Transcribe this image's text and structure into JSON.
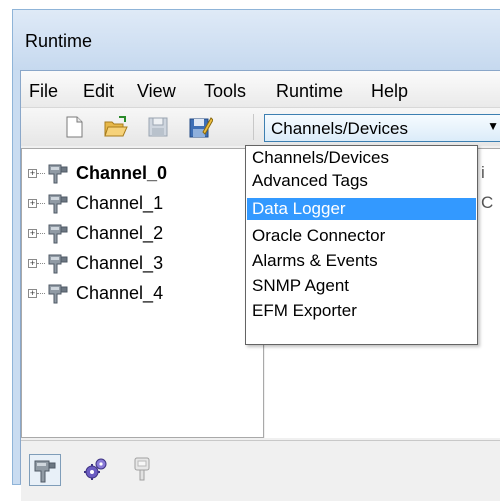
{
  "window": {
    "title": "Runtime"
  },
  "menu": [
    "File",
    "Edit",
    "View",
    "Tools",
    "Runtime",
    "Help"
  ],
  "toolbar": {
    "buttons": [
      "new-document-icon",
      "open-folder-icon",
      "save-icon",
      "save-as-icon"
    ],
    "view_selector": "Channels/Devices"
  },
  "tree": {
    "items": [
      {
        "label": "Channel_0",
        "bold": true
      },
      {
        "label": "Channel_1",
        "bold": false
      },
      {
        "label": "Channel_2",
        "bold": false
      },
      {
        "label": "Channel_3",
        "bold": false
      },
      {
        "label": "Channel_4",
        "bold": false
      }
    ]
  },
  "right_pane": {
    "fragment_1": "i",
    "fragment_2": "C"
  },
  "dropdown": {
    "items": [
      "Channels/Devices",
      "Advanced Tags",
      "Data Logger",
      "Oracle Connector",
      "Alarms & Events",
      "SNMP Agent",
      "EFM Exporter"
    ],
    "highlighted_index": 2
  },
  "bottom_toolbar": {
    "buttons": [
      "channel-view-icon",
      "gears-icon",
      "device-disabled-icon"
    ],
    "active_index": 0
  },
  "colors": {
    "highlight": "#3399ff",
    "title_bar": "#c9dcf1",
    "add_icon": "#3c9a2a"
  }
}
